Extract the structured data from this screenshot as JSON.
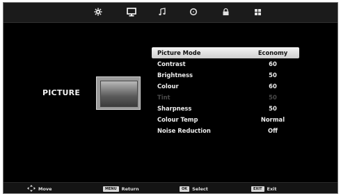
{
  "menu_title": "PICTURE",
  "topbar": {
    "icons": [
      "gear-icon",
      "monitor-icon",
      "music-note-icon",
      "clock-icon",
      "lock-icon",
      "grid-icon"
    ],
    "active_index": 1
  },
  "settings": [
    {
      "label": "Picture Mode",
      "value": "Economy",
      "selected": true,
      "disabled": false
    },
    {
      "label": "Contrast",
      "value": "60",
      "selected": false,
      "disabled": false
    },
    {
      "label": "Brightness",
      "value": "50",
      "selected": false,
      "disabled": false
    },
    {
      "label": "Colour",
      "value": "60",
      "selected": false,
      "disabled": false
    },
    {
      "label": "Tint",
      "value": "50",
      "selected": false,
      "disabled": true
    },
    {
      "label": "Sharpness",
      "value": "50",
      "selected": false,
      "disabled": false
    },
    {
      "label": "Colour Temp",
      "value": "Normal",
      "selected": false,
      "disabled": false
    },
    {
      "label": "Noise Reduction",
      "value": "Off",
      "selected": false,
      "disabled": false
    }
  ],
  "footer": {
    "move_label": "Move",
    "menu_key": "MENU",
    "return_label": "Return",
    "ok_key": "OK",
    "select_label": "Select",
    "exit_key": "EXIT",
    "exit_label": "Exit"
  },
  "colors": {
    "background": "#000000",
    "highlight": "#e6e6e6",
    "text": "#ededed",
    "disabled_text": "#4a4a4a"
  }
}
